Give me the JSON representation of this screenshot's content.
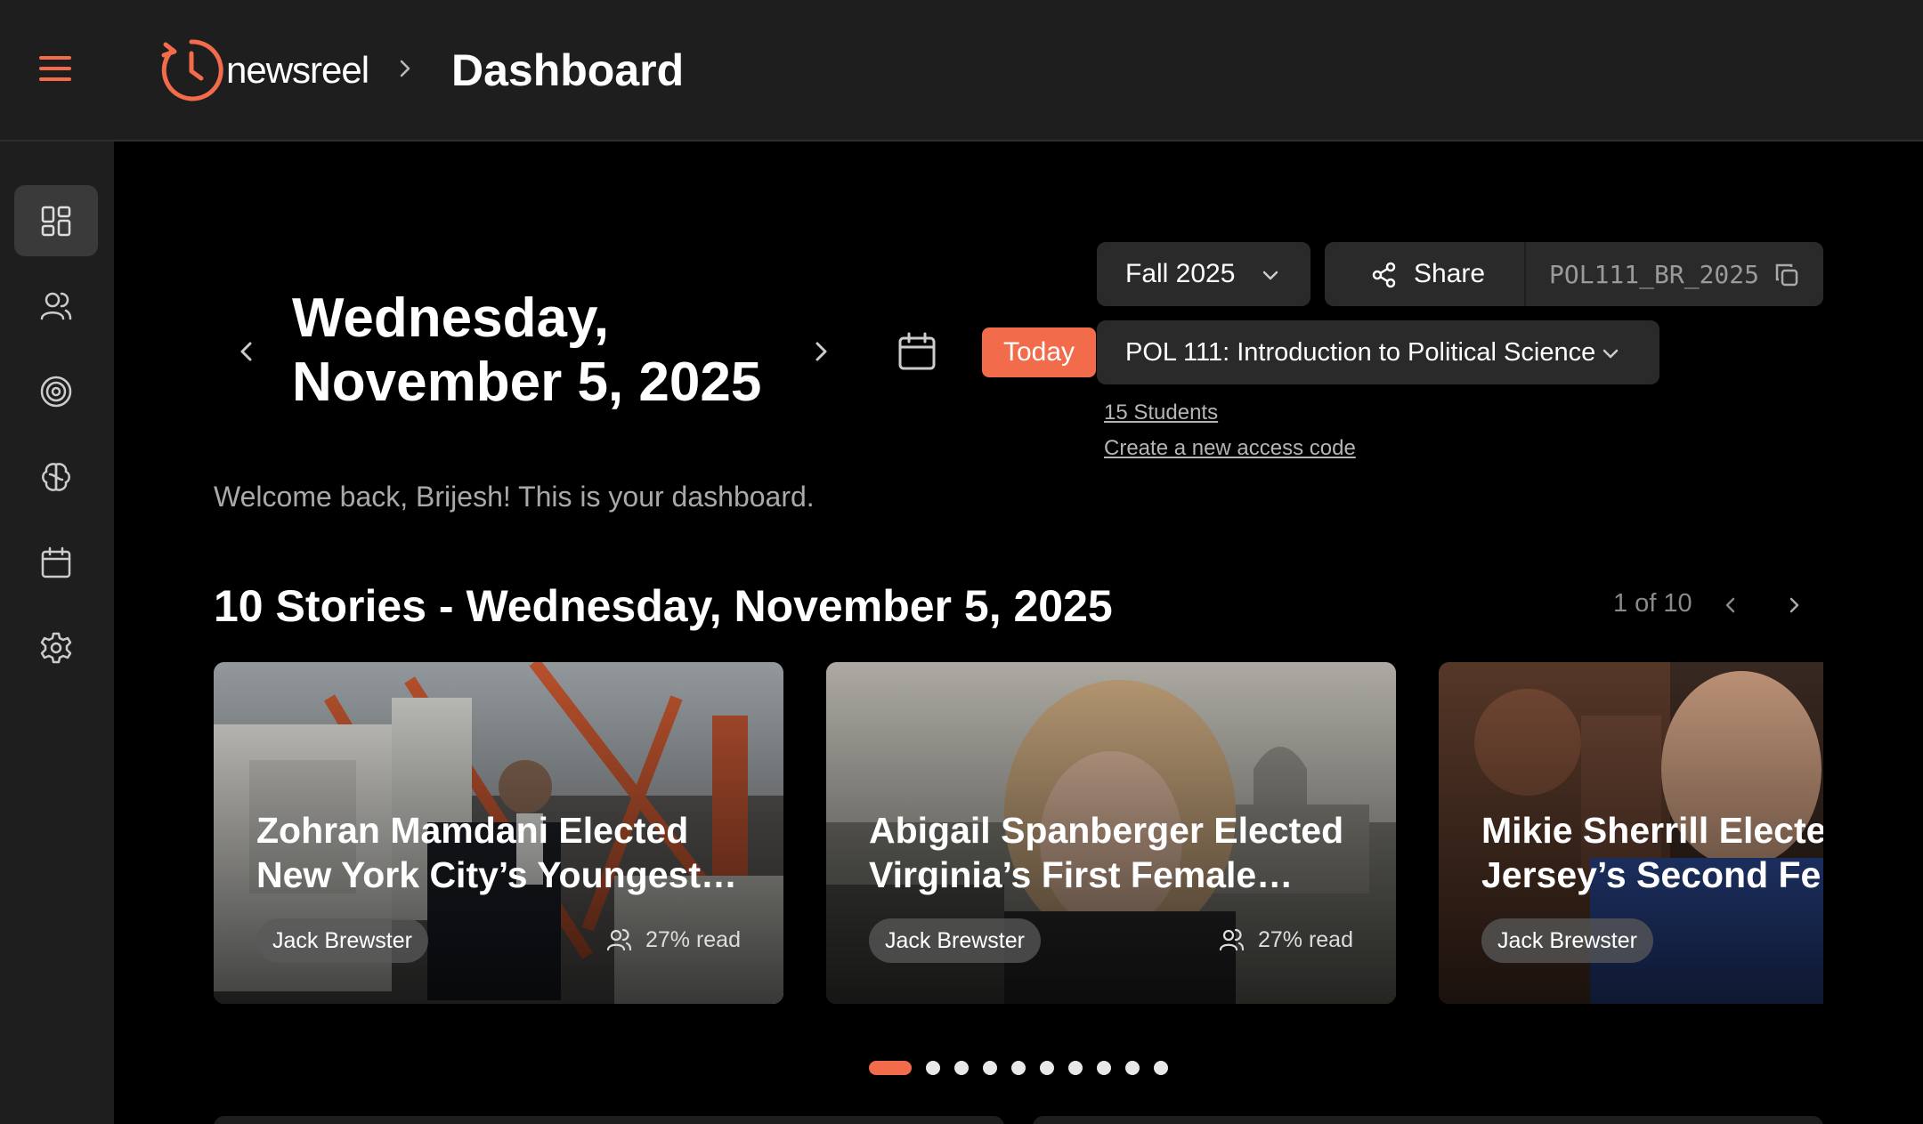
{
  "app": {
    "name": "newsreel",
    "page_title": "Dashboard",
    "brand_color": "#f26b4b"
  },
  "sidebar": {
    "items": [
      {
        "name": "dashboard",
        "icon": "dashboard-grid-icon",
        "active": true
      },
      {
        "name": "students",
        "icon": "users-icon"
      },
      {
        "name": "goals",
        "icon": "target-icon"
      },
      {
        "name": "insights",
        "icon": "brain-icon"
      },
      {
        "name": "calendar",
        "icon": "calendar-icon"
      },
      {
        "name": "settings",
        "icon": "gear-icon"
      }
    ]
  },
  "date_nav": {
    "line1": "Wednesday,",
    "line2": "November 5, 2025",
    "today_label": "Today"
  },
  "controls": {
    "term": "Fall 2025",
    "share_label": "Share",
    "access_code": "POL111_BR_2025",
    "course": "POL 111: Introduction to Political Science",
    "students_link": "15 Students",
    "access_code_link": "Create a new access code"
  },
  "welcome": "Welcome back, Brijesh! This is your dashboard.",
  "stories": {
    "title": "10 Stories - Wednesday, November 5, 2025",
    "pager": "1 of 10",
    "cards": [
      {
        "line1": "Zohran Mamdani Elected",
        "line2": "New York City’s Youngest…",
        "author": "Jack Brewster",
        "read": "27% read"
      },
      {
        "line1": "Abigail Spanberger Elected",
        "line2": "Virginia’s First Female…",
        "author": "Jack Brewster",
        "read": "27% read"
      },
      {
        "line1": "Mikie Sherrill Elected New",
        "line2": "Jersey’s Second Female…",
        "author": "Jack Brewster",
        "read": ""
      }
    ],
    "dot_count": 10,
    "active_dot": 0
  }
}
